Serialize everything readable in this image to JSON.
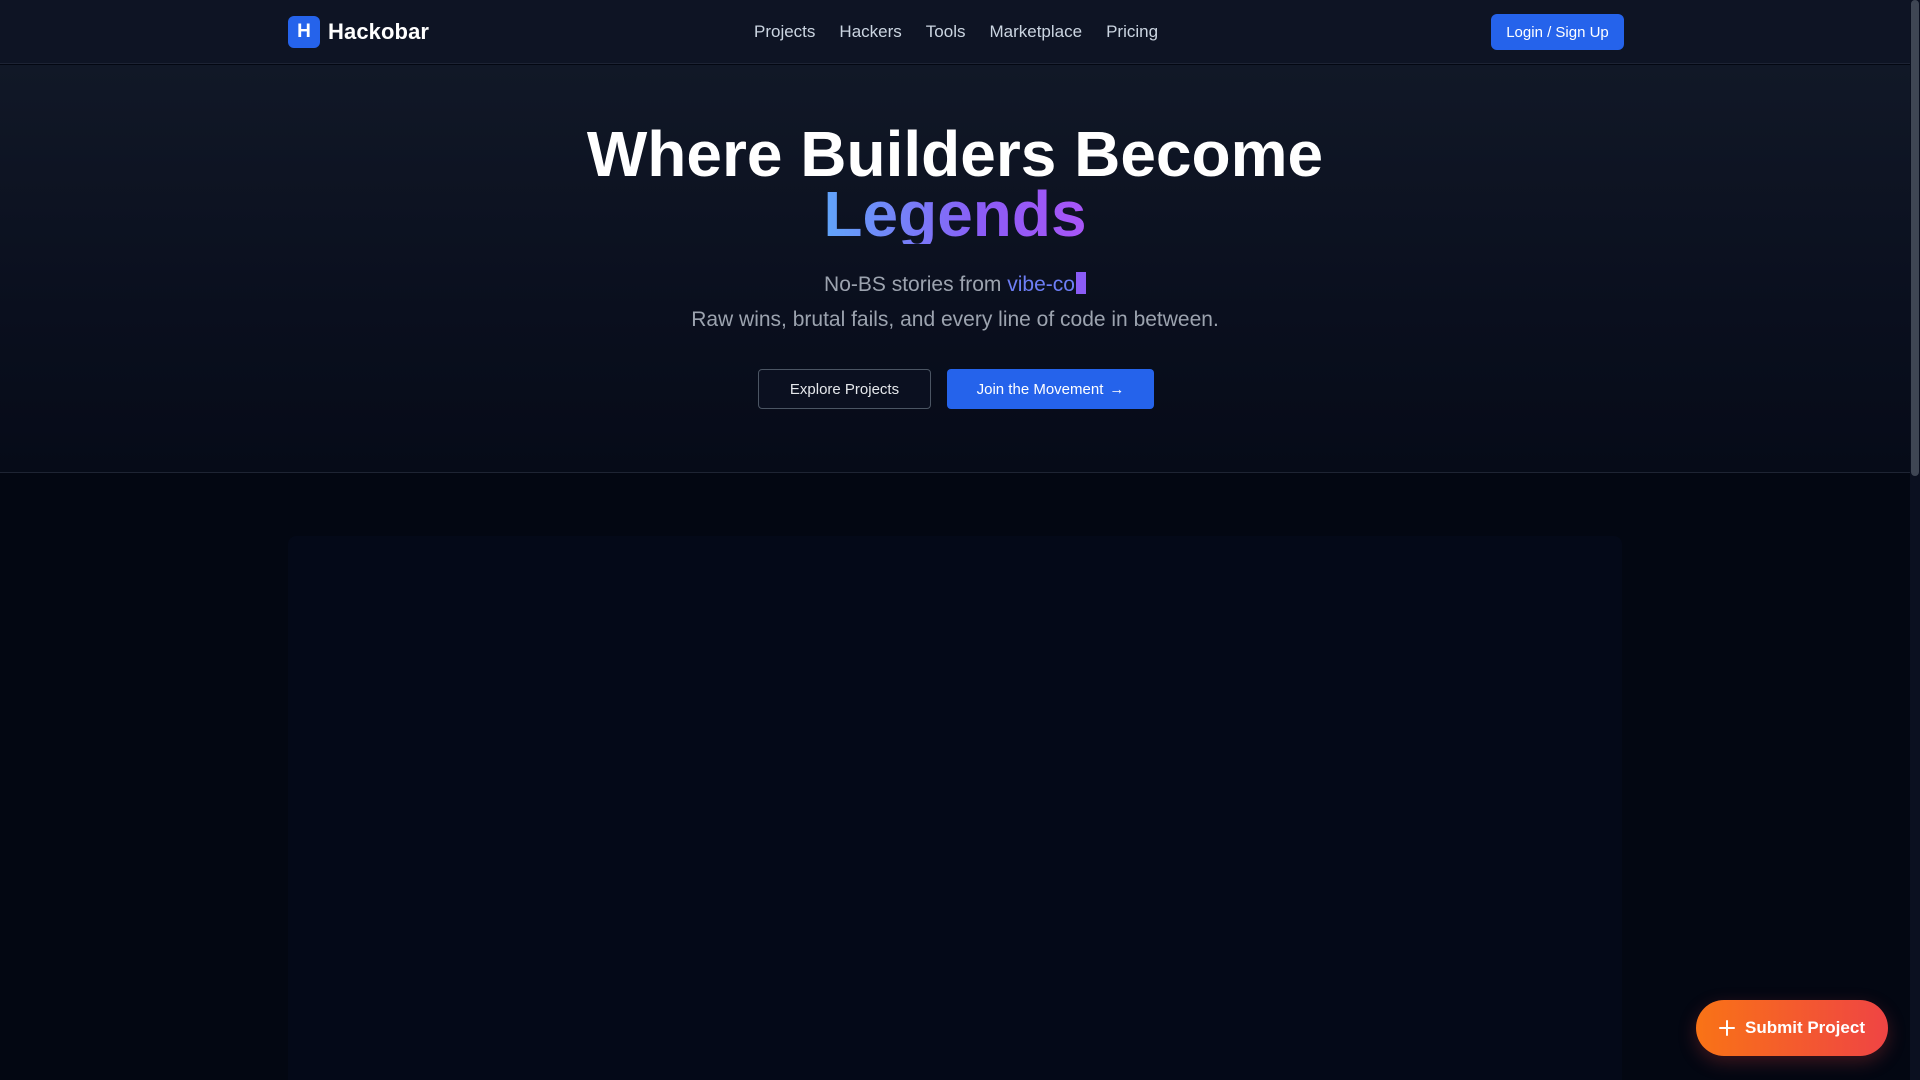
{
  "navbar": {
    "logo_letter": "H",
    "brand_name": "Hackobar",
    "links": [
      {
        "label": "Projects"
      },
      {
        "label": "Hackers"
      },
      {
        "label": "Tools"
      },
      {
        "label": "Marketplace"
      },
      {
        "label": "Pricing"
      }
    ],
    "login_label": "Login / Sign Up"
  },
  "hero": {
    "title_line1": "Where Builders Become",
    "title_line2": "Legends",
    "subtitle_prefix": "No-BS stories from ",
    "subtitle_typed": "vibe-co",
    "subtitle_line2": "Raw wins, brutal fails, and every line of code in between.",
    "explore_label": "Explore Projects",
    "join_label": "Join the Movement",
    "join_arrow": "→"
  },
  "fab": {
    "label": "Submit Project",
    "icon": "plus-icon"
  },
  "colors": {
    "brand": "#2563eb",
    "gradient_start": "#60a5fa",
    "gradient_end": "#a855f7",
    "fab_start": "#f97316",
    "fab_end": "#ef4444",
    "background": "#030712"
  }
}
